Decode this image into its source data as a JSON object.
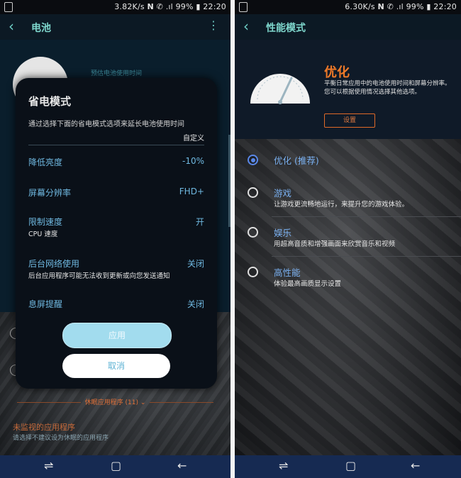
{
  "left": {
    "status": {
      "text": "3.82K/s 𝗡 ✆ .ıl 99% ▮ 22:20"
    },
    "appbar": {
      "back": "‹",
      "title": "电池",
      "more": "⋮"
    },
    "background": {
      "predicted_label": "预估电池使用时间",
      "hibernate_toggle": "休眠应用程序 (11) ⌄",
      "unmonitored_title": "未监视的应用程序",
      "unmonitored_desc": "请选择不建议设为休眠的应用程序"
    },
    "dialog": {
      "title": "省电模式",
      "description": "通过选择下面的省电模式选项来延长电池使用时间",
      "custom_label": "自定义",
      "rows": [
        {
          "label": "降低亮度",
          "value": "-10%",
          "sub": ""
        },
        {
          "label": "屏幕分辨率",
          "value": "FHD+",
          "sub": ""
        },
        {
          "label": "限制速度",
          "value": "开",
          "sub": "CPU 速度"
        },
        {
          "label": "后台网络使用",
          "value": "关闭",
          "sub": "后台应用程序可能无法收到更新或向您发送通知"
        },
        {
          "label": "息屏提醒",
          "value": "关闭",
          "sub": ""
        }
      ],
      "apply_label": "应用",
      "cancel_label": "取消"
    },
    "navbar": {
      "recent": "⇌",
      "home": "▢",
      "back": "←"
    }
  },
  "right": {
    "status": {
      "text": "6.30K/s 𝗡 ✆ .ıl 99% ▮ 22:20"
    },
    "appbar": {
      "back": "‹",
      "title": "性能模式"
    },
    "header": {
      "mode_title": "优化",
      "mode_desc": "平衡日常应用中的电池使用时间和屏幕分辨率。您可以根据使用情况选择其他选项。",
      "settings_label": "设置"
    },
    "options": [
      {
        "title": "优化 (推荐)",
        "desc": "",
        "selected": true
      },
      {
        "title": "游戏",
        "desc": "让游戏更流畅地运行，来提升您的游戏体验。",
        "selected": false
      },
      {
        "title": "娱乐",
        "desc": "用超高音质和增强画面来欣赏音乐和视频",
        "selected": false
      },
      {
        "title": "高性能",
        "desc": "体验最高画质显示设置",
        "selected": false
      }
    ],
    "navbar": {
      "recent": "⇌",
      "home": "▢",
      "back": "←"
    }
  },
  "colors": {
    "accent_teal": "#7ed6cc",
    "accent_blue": "#6fb8e0",
    "accent_orange": "#f07a28",
    "navbar": "#162a52"
  }
}
